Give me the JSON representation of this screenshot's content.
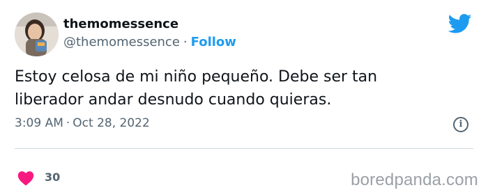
{
  "tweet": {
    "display_name": "themomessence",
    "handle": "@themomessence",
    "separator": "·",
    "follow_label": "Follow",
    "text": "Estoy celosa de mi niño pequeño. Debe ser tan liberador andar desnudo cuando quieras.",
    "time": "3:09 AM",
    "date": "Oct 28, 2022",
    "like_count": "30"
  },
  "watermark": "boredpanda.com",
  "icons": {
    "brand": "twitter-bird-icon",
    "info": "info-icon",
    "like": "heart-icon"
  },
  "colors": {
    "accent": "#1d9bf0",
    "like": "#f91880",
    "secondary_text": "#536471"
  }
}
